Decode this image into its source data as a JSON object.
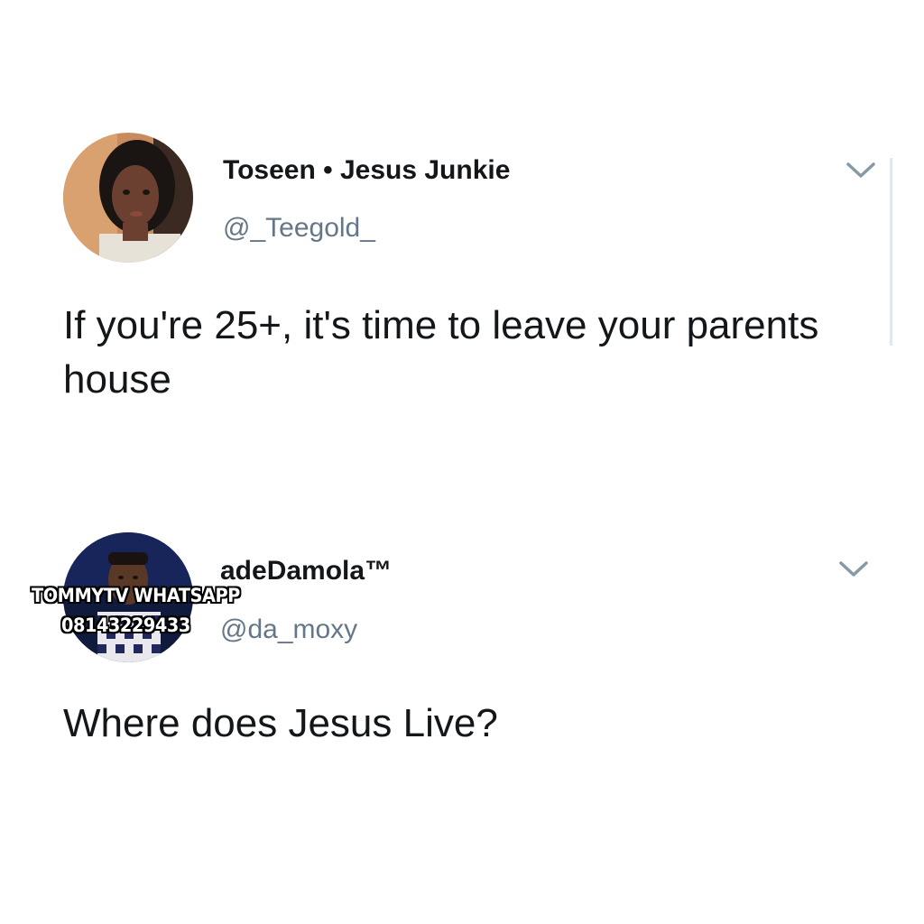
{
  "tweets": [
    {
      "display_name": "Toseen • Jesus Junkie",
      "handle": "@_Teegold_",
      "text": "If you're 25+, it's time to leave your parents house",
      "avatar_icon": "profile-photo-icon"
    },
    {
      "display_name": "adeDamola™",
      "handle": "@da_moxy",
      "text": "Where does Jesus Live?",
      "avatar_icon": "profile-photo-icon"
    }
  ],
  "watermark": {
    "line1": "TOMMYTV WHATSAPP",
    "line2": "08143229433"
  },
  "colors": {
    "text": "#14171a",
    "handle": "#657786",
    "chevron": "#8899a6",
    "divider": "#e1e8ed"
  },
  "icons": {
    "menu": "chevron-down-icon"
  }
}
